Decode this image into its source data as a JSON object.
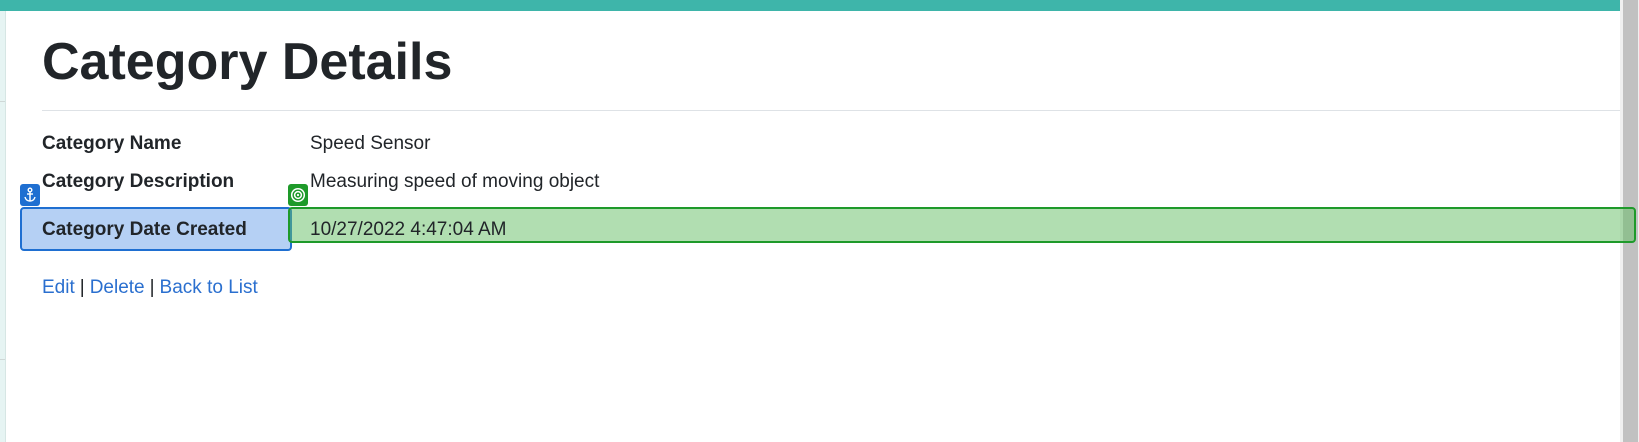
{
  "page": {
    "title": "Category Details"
  },
  "details": [
    {
      "label": "Category Name",
      "value": "Speed Sensor"
    },
    {
      "label": "Category Description",
      "value": "Measuring speed of moving object"
    },
    {
      "label": "Category Date Created",
      "value": "10/27/2022 4:47:04 AM"
    }
  ],
  "actions": {
    "edit": "Edit",
    "delete": "Delete",
    "back": "Back to List",
    "separator": "|"
  },
  "annotations": {
    "anchor_icon": "anchor-icon",
    "target_icon": "target-icon",
    "label_highlight_color": "#1f6fd1",
    "value_highlight_color": "#1e9a2a"
  },
  "colors": {
    "accent": "#3eb5aa",
    "link": "#2a6fcf",
    "text": "#212529"
  }
}
